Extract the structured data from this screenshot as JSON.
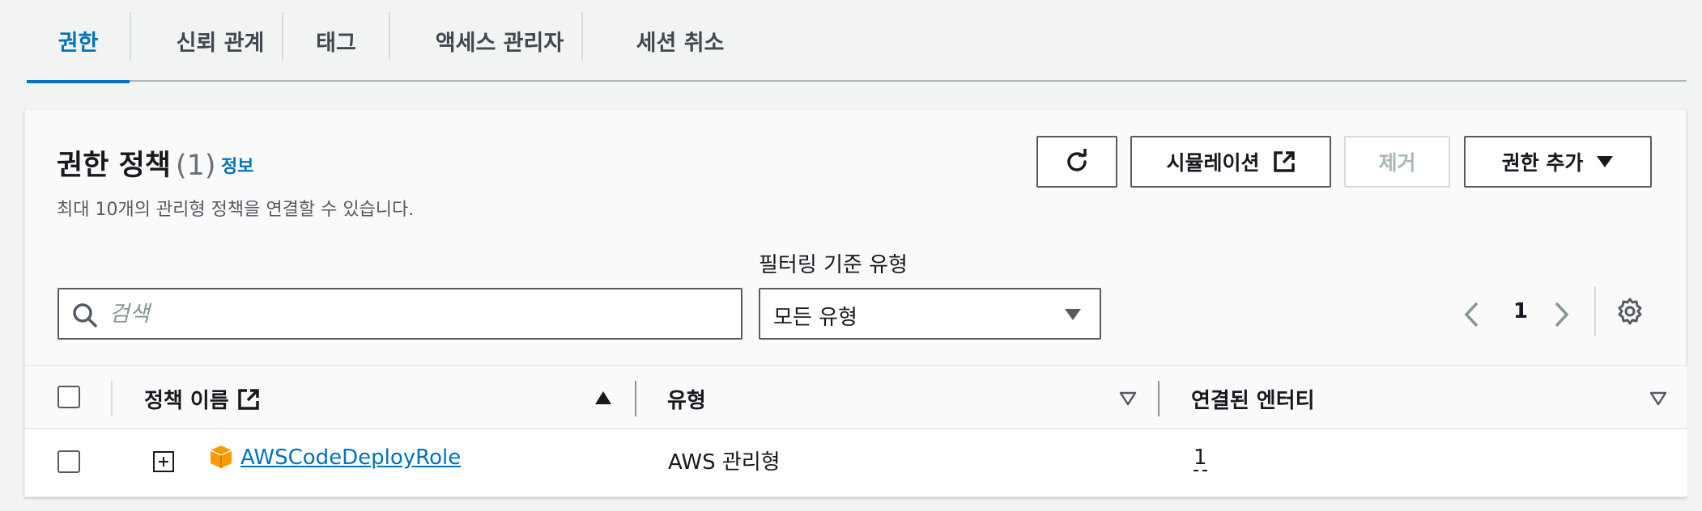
{
  "tabs": [
    {
      "label": "권한",
      "active": true
    },
    {
      "label": "신뢰 관계",
      "active": false
    },
    {
      "label": "태그",
      "active": false
    },
    {
      "label": "액세스 관리자",
      "active": false
    },
    {
      "label": "세션 취소",
      "active": false
    }
  ],
  "panel": {
    "title": "권한 정책",
    "count": "(1)",
    "info": "정보",
    "description": "최대 10개의 관리형 정책을 연결할 수 있습니다."
  },
  "actions": {
    "refresh_icon": "refresh-icon",
    "simulation": "시뮬레이션",
    "remove": "제거",
    "add_permissions": "권한 추가"
  },
  "filter": {
    "search_placeholder": "검색",
    "type_label": "필터링 기준 유형",
    "type_value": "모든 유형"
  },
  "pagination": {
    "current": "1"
  },
  "table": {
    "columns": [
      "정책 이름",
      "유형",
      "연결된 엔터티"
    ],
    "rows": [
      {
        "name": "AWSCodeDeployRole",
        "type": "AWS 관리형",
        "entities": "1"
      }
    ]
  },
  "colors": {
    "accent": "#0073bb",
    "text": "#16191f",
    "muted": "#687078",
    "icon_orange": "#f90"
  }
}
